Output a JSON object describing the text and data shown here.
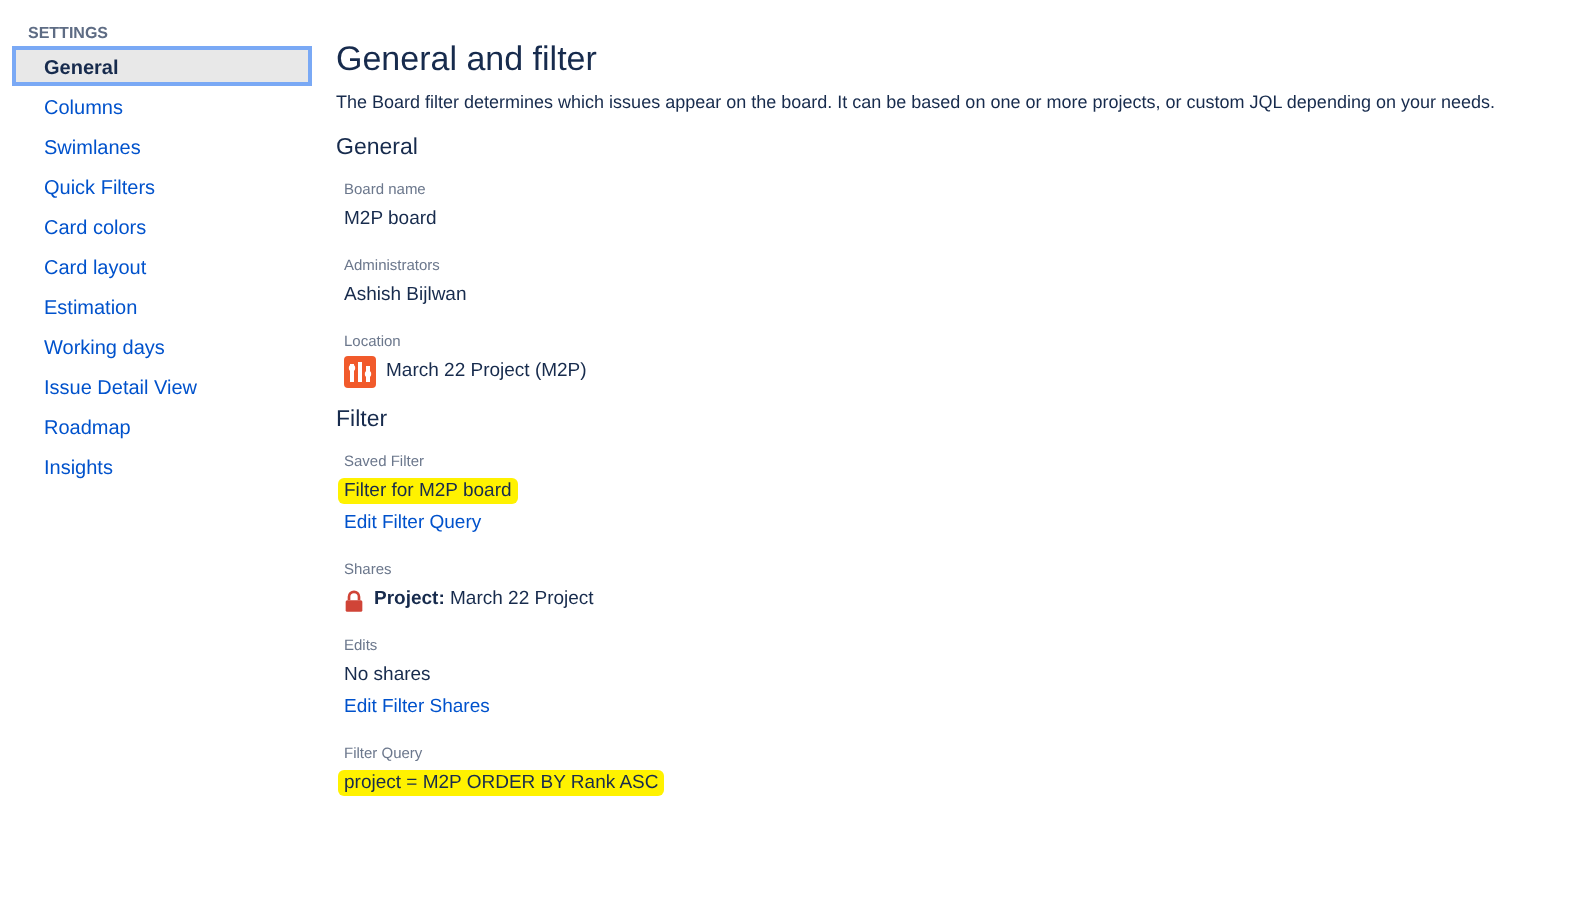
{
  "sidebar": {
    "heading": "SETTINGS",
    "items": [
      {
        "label": "General",
        "selected": true
      },
      {
        "label": "Columns",
        "selected": false
      },
      {
        "label": "Swimlanes",
        "selected": false
      },
      {
        "label": "Quick Filters",
        "selected": false
      },
      {
        "label": "Card colors",
        "selected": false
      },
      {
        "label": "Card layout",
        "selected": false
      },
      {
        "label": "Estimation",
        "selected": false
      },
      {
        "label": "Working days",
        "selected": false
      },
      {
        "label": "Issue Detail View",
        "selected": false
      },
      {
        "label": "Roadmap",
        "selected": false
      },
      {
        "label": "Insights",
        "selected": false
      }
    ]
  },
  "page": {
    "title": "General and filter",
    "description": "The Board filter determines which issues appear on the board. It can be based on one or more projects, or custom JQL depending on your needs.",
    "sections": [
      {
        "heading": "General",
        "fields": [
          {
            "label": "Board name",
            "lines": [
              {
                "kind": "text",
                "text": "M2P board",
                "highlighted": false
              }
            ]
          },
          {
            "label": "Administrators",
            "lines": [
              {
                "kind": "text",
                "text": "Ashish Bijlwan",
                "highlighted": false
              }
            ]
          },
          {
            "label": "Location",
            "lines": [
              {
                "kind": "project",
                "text": "March 22 Project (M2P)",
                "highlighted": false
              }
            ]
          }
        ]
      },
      {
        "heading": "Filter",
        "fields": [
          {
            "label": "Saved Filter",
            "lines": [
              {
                "kind": "text",
                "text": "Filter for M2P board",
                "highlighted": true
              },
              {
                "kind": "link",
                "text": "Edit Filter Query",
                "highlighted": false
              }
            ]
          },
          {
            "label": "Shares",
            "lines": [
              {
                "kind": "share",
                "text": "**Project:** March 22 Project",
                "highlighted": false
              }
            ]
          },
          {
            "label": "Edits",
            "lines": [
              {
                "kind": "text",
                "text": "No shares",
                "highlighted": false
              },
              {
                "kind": "link",
                "text": "Edit Filter Shares",
                "highlighted": false
              }
            ]
          },
          {
            "label": "Filter Query",
            "lines": [
              {
                "kind": "text",
                "text": "project = M2P ORDER BY Rank ASC",
                "highlighted": true
              }
            ]
          }
        ]
      }
    ]
  }
}
